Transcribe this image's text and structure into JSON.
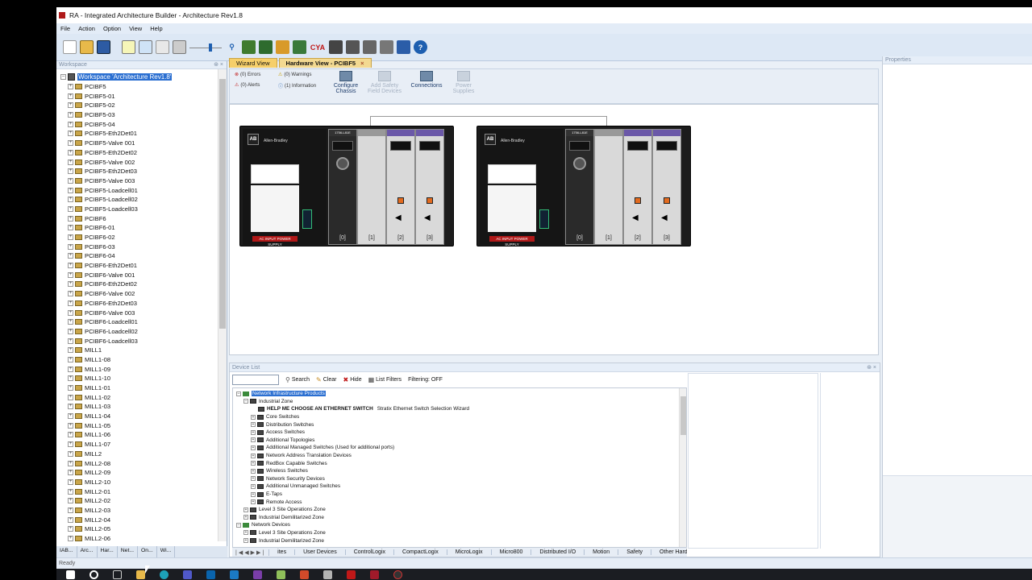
{
  "window": {
    "title": "RA - Integrated Architecture Builder - Architecture Rev1.8"
  },
  "menu": [
    "File",
    "Action",
    "Option",
    "View",
    "Help"
  ],
  "toolbar_icons": [
    "new-icon",
    "open-icon",
    "save-icon",
    "layout-icon",
    "layout-icon",
    "layout-icon",
    "calculator-icon",
    "zoom-slider",
    "zoom-icon",
    "chassis-icon",
    "network-icon",
    "connect-icon",
    "bom-icon",
    "cya-icon",
    "rack-icon",
    "io-icon",
    "export-icon",
    "import-icon",
    "word-icon",
    "help-icon"
  ],
  "toolbar_cya": "CYA",
  "workspace": {
    "header": "Workspace",
    "root": "Workspace 'Architecture Rev1.8'",
    "items": [
      "PCIBF5",
      "PCIBF5-01",
      "PCIBF5-02",
      "PCIBF5-03",
      "PCIBF5-04",
      "PCIBF5-Eth2Det01",
      "PCIBF5-Valve 001",
      "PCIBF5-Eth2Det02",
      "PCIBF5-Valve 002",
      "PCIBF5-Eth2Det03",
      "PCIBF5-Valve 003",
      "PCIBF5-Loadcell01",
      "PCIBF5-Loadcell02",
      "PCIBF5-Loadcell03",
      "PCIBF6",
      "PCIBF6-01",
      "PCIBF6-02",
      "PCIBF6-03",
      "PCIBF6-04",
      "PCIBF6-Eth2Det01",
      "PCIBF6-Valve 001",
      "PCIBF6-Eth2Det02",
      "PCIBF6-Valve 002",
      "PCIBF6-Eth2Det03",
      "PCIBF6-Valve 003",
      "PCIBF6-Loadcell01",
      "PCIBF6-Loadcell02",
      "PCIBF6-Loadcell03",
      "MILL1",
      "MILL1-08",
      "MILL1-09",
      "MILL1-10",
      "MILL1-01",
      "MILL1-02",
      "MILL1-03",
      "MILL1-04",
      "MILL1-05",
      "MILL1-06",
      "MILL1-07",
      "MILL2",
      "MILL2-08",
      "MILL2-09",
      "MILL2-10",
      "MILL2-01",
      "MILL2-02",
      "MILL2-03",
      "MILL2-04",
      "MILL2-05",
      "MILL2-06"
    ],
    "tabs": [
      "IAB...",
      "Arc...",
      "Har...",
      "Net...",
      "On...",
      "Wi..."
    ]
  },
  "doc_tabs": {
    "wizard": "Wizard View",
    "hardware": "Hardware View - PCIBF5"
  },
  "ribbon": {
    "errors": "(0) Errors",
    "warnings": "(0) Warnings",
    "alerts": "(0) Alerts",
    "information": "(1) Information",
    "configure_chassis_1": "Configure",
    "configure_chassis_2": "Chassis",
    "add_safety_1": "Add Safety",
    "add_safety_2": "Field Devices",
    "connections": "Connections",
    "power_supplies_1": "Power",
    "power_supplies_2": "Supplies"
  },
  "chassis": [
    {
      "cpu": "1756-L81E",
      "brand": "Allen-Bradley",
      "logo": "AB",
      "power": "AC INPUT POWER SUPPLY",
      "slots": [
        "[0]",
        "[1]",
        "[2]",
        "[3]"
      ]
    },
    {
      "cpu": "1756-L81E",
      "brand": "Allen-Bradley",
      "logo": "AB",
      "power": "AC INPUT POWER SUPPLY",
      "slots": [
        "[0]",
        "[1]",
        "[2]",
        "[3]"
      ]
    }
  ],
  "properties": {
    "header": "Properties"
  },
  "device_list": {
    "header": "Device List",
    "search": "Search",
    "clear": "Clear",
    "hide": "Hide",
    "list_filters": "List Filters",
    "filtering": "Filtering: OFF",
    "tree": [
      {
        "level": 0,
        "kind": "net",
        "label": "Network Infrastructure Products",
        "selected": true
      },
      {
        "level": 1,
        "kind": "cat",
        "label": "Industrial Zone"
      },
      {
        "level": 2,
        "kind": "cat",
        "label": "HELP ME CHOOSE AN ETHERNET SWITCH",
        "bold": true,
        "desc": "Stratix Ethernet Switch Selection Wizard"
      },
      {
        "level": 2,
        "kind": "cat",
        "label": "Core Switches"
      },
      {
        "level": 2,
        "kind": "cat",
        "label": "Distribution Switches"
      },
      {
        "level": 2,
        "kind": "cat",
        "label": "Access Switches"
      },
      {
        "level": 2,
        "kind": "cat",
        "label": "Additional Topologies"
      },
      {
        "level": 2,
        "kind": "cat",
        "label": "Additional Managed Switches (Used for additional ports)"
      },
      {
        "level": 2,
        "kind": "cat",
        "label": "Network Address Translation Devices"
      },
      {
        "level": 2,
        "kind": "cat",
        "label": "RedBox Capable Switches"
      },
      {
        "level": 2,
        "kind": "cat",
        "label": "Wireless Switches"
      },
      {
        "level": 2,
        "kind": "cat",
        "label": "Network Security Devices"
      },
      {
        "level": 2,
        "kind": "cat",
        "label": "Additional Unmanaged Switches"
      },
      {
        "level": 2,
        "kind": "cat",
        "label": "E-Taps"
      },
      {
        "level": 2,
        "kind": "cat",
        "label": "Remote Access"
      },
      {
        "level": 1,
        "kind": "cat",
        "label": "Level 3 Site Operations Zone"
      },
      {
        "level": 1,
        "kind": "cat",
        "label": "Industrial Demilitarized Zone"
      },
      {
        "level": 0,
        "kind": "net",
        "label": "Network Devices"
      },
      {
        "level": 1,
        "kind": "cat",
        "label": "Level 3 Site Operations Zone"
      },
      {
        "level": 1,
        "kind": "cat",
        "label": "Industrial Demilitarized Zone"
      }
    ],
    "categories": [
      "ites",
      "User Devices",
      "ControlLogix",
      "CompactLogix",
      "MicroLogix",
      "Micro800",
      "Distributed I/O",
      "Motion",
      "Safety",
      "Other Hardware"
    ]
  },
  "status": "Ready",
  "colors": {
    "selection": "#2b6fd1",
    "tab_active": "#f3d991",
    "accent_red": "#b01818"
  }
}
